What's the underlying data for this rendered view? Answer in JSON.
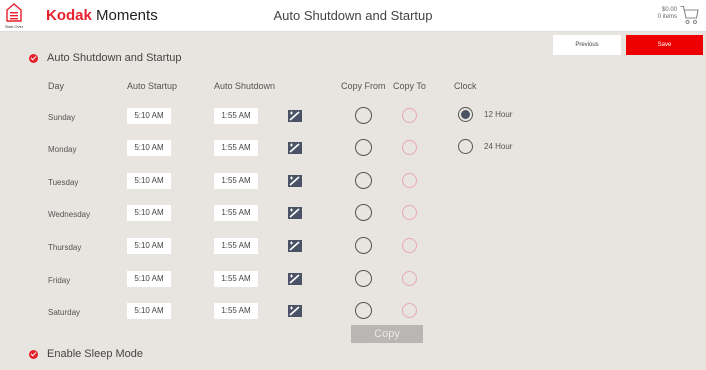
{
  "header": {
    "home_label": "Start Over",
    "brand_bold": "Kodak",
    "brand_rest": " Moments",
    "title": "Auto Shutdown and Startup",
    "cart_total": "$0.00",
    "cart_items": "0 items"
  },
  "actions": {
    "previous": "Previous",
    "save": "Save"
  },
  "section": {
    "title": "Auto Shutdown and Startup",
    "columns": {
      "day": "Day",
      "startup": "Auto Startup",
      "shutdown": "Auto Shutdown",
      "copy_from": "Copy From",
      "copy_to": "Copy To",
      "clock": "Clock"
    },
    "rows": [
      {
        "day": "Sunday",
        "startup": "5:10 AM",
        "shutdown": "1:55 AM"
      },
      {
        "day": "Monday",
        "startup": "5:10 AM",
        "shutdown": "1:55 AM"
      },
      {
        "day": "Tuesday",
        "startup": "5:10 AM",
        "shutdown": "1:55 AM"
      },
      {
        "day": "Wednesday",
        "startup": "5:10 AM",
        "shutdown": "1:55 AM"
      },
      {
        "day": "Thursday",
        "startup": "5:10 AM",
        "shutdown": "1:55 AM"
      },
      {
        "day": "Friday",
        "startup": "5:10 AM",
        "shutdown": "1:55 AM"
      },
      {
        "day": "Saturday",
        "startup": "5:10 AM",
        "shutdown": "1:55 AM"
      }
    ],
    "clock_options": [
      {
        "label": "12 Hour",
        "selected": true
      },
      {
        "label": "24 Hour",
        "selected": false
      }
    ],
    "copy_button": "Copy"
  },
  "sleep": {
    "title": "Enable Sleep Mode"
  },
  "colors": {
    "accent": "#e8212e",
    "save": "#ee0000",
    "background": "#e8e4df",
    "copy_to_ring": "#e9a9ad"
  },
  "icons": {
    "home": "home-icon",
    "cart": "cart-icon",
    "edit": "edit-time-icon",
    "check": "check-icon"
  }
}
